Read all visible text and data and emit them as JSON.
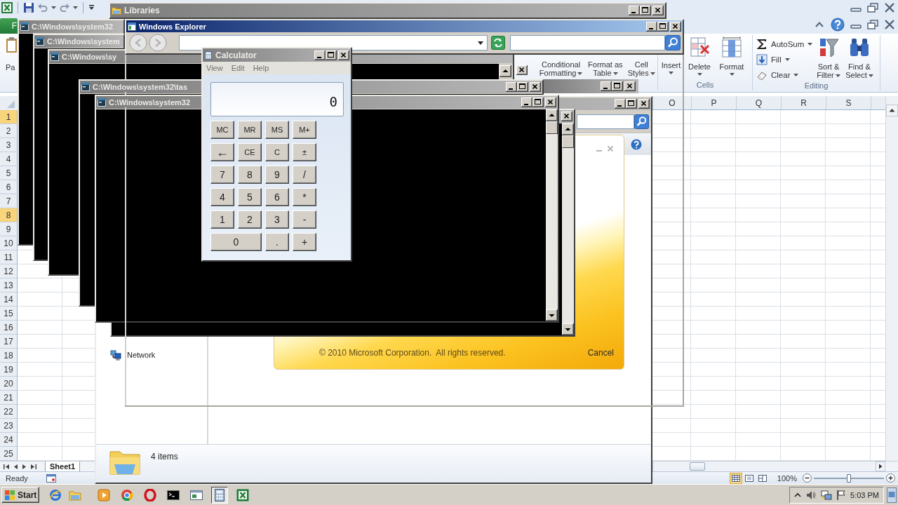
{
  "excel": {
    "file_tab": "F",
    "paste_label": "Pa",
    "styles_buttons": [
      "Conditional Formatting",
      "Format as Table",
      "Cell Styles"
    ],
    "cells_buttons": [
      "Insert",
      "Delete",
      "Format"
    ],
    "cells_group": "Cells",
    "editing_small": [
      "AutoSum",
      "Fill",
      "Clear"
    ],
    "editing_large": [
      "Sort & Filter",
      "Find & Select"
    ],
    "editing_group": "Editing",
    "columns": [
      "O",
      "P",
      "Q",
      "R",
      "S"
    ],
    "rows": [
      {
        "label": "1",
        "selected": true
      },
      {
        "label": "2",
        "selected": false
      },
      {
        "label": "3",
        "selected": false
      },
      {
        "label": "4",
        "selected": false
      },
      {
        "label": "5",
        "selected": false
      },
      {
        "label": "6",
        "selected": false
      },
      {
        "label": "7",
        "selected": false
      },
      {
        "label": "8",
        "selected": true
      },
      {
        "label": "9",
        "selected": false
      },
      {
        "label": "10",
        "selected": false
      },
      {
        "label": "11",
        "selected": false
      },
      {
        "label": "12",
        "selected": false
      },
      {
        "label": "13",
        "selected": false
      },
      {
        "label": "14",
        "selected": false
      },
      {
        "label": "15",
        "selected": false
      },
      {
        "label": "16",
        "selected": false
      },
      {
        "label": "17",
        "selected": false
      },
      {
        "label": "18",
        "selected": false
      },
      {
        "label": "19",
        "selected": false
      },
      {
        "label": "20",
        "selected": false
      },
      {
        "label": "21",
        "selected": false
      },
      {
        "label": "22",
        "selected": false
      },
      {
        "label": "23",
        "selected": false
      },
      {
        "label": "24",
        "selected": false
      },
      {
        "label": "25",
        "selected": false
      }
    ],
    "sheet_tabs": [
      {
        "label": "Sheet1",
        "selected": true
      }
    ],
    "status": "Ready",
    "view_buttons": [
      {
        "selected": true
      },
      {
        "selected": false
      },
      {
        "selected": false
      }
    ],
    "zoom": {
      "reading": "100%",
      "level": 0.5
    }
  },
  "libraries_window": {
    "title": "Libraries",
    "active": false
  },
  "consoles": [
    {
      "title": "C:\\Windows\\system32",
      "active": false
    },
    {
      "title": "C:\\Windows\\system",
      "active": false
    },
    {
      "title": "C:\\Windows\\sy",
      "active": false
    },
    {
      "title": "C:\\Windows\\system32\\tas",
      "active": false
    },
    {
      "title": "C:\\Windows\\system32",
      "active": false
    }
  ],
  "folder_window": {
    "active": false,
    "nav_items": [
      {
        "label": "Network"
      }
    ],
    "status": "4 items"
  },
  "setup_splash": {
    "copyright": "© 2010 Microsoft Corporation.  All rights reserved.",
    "cancel": "Cancel"
  },
  "explorer_window": {
    "title": "Windows Explorer",
    "active": true
  },
  "calculator": {
    "title": "Calculator",
    "active": false,
    "menu": [
      "View",
      "Edit",
      "Help"
    ],
    "display": "0",
    "keys": [
      {
        "label": "MC",
        "kind": "small"
      },
      {
        "label": "MR",
        "kind": "small"
      },
      {
        "label": "MS",
        "kind": "small"
      },
      {
        "label": "M+",
        "kind": "small"
      },
      {
        "label": "←",
        "kind": "arrow"
      },
      {
        "label": "CE",
        "kind": "small"
      },
      {
        "label": "C",
        "kind": "small"
      },
      {
        "label": "±",
        "kind": "small"
      },
      {
        "label": "7",
        "kind": "digit"
      },
      {
        "label": "8",
        "kind": "digit"
      },
      {
        "label": "9",
        "kind": "digit"
      },
      {
        "label": "/",
        "kind": "digit"
      },
      {
        "label": "4",
        "kind": "digit"
      },
      {
        "label": "5",
        "kind": "digit"
      },
      {
        "label": "6",
        "kind": "digit"
      },
      {
        "label": "*",
        "kind": "digit"
      },
      {
        "label": "1",
        "kind": "digit"
      },
      {
        "label": "2",
        "kind": "digit"
      },
      {
        "label": "3",
        "kind": "digit"
      },
      {
        "label": "-",
        "kind": "digit"
      },
      {
        "label": "0",
        "kind": "wide"
      },
      {
        "label": ".",
        "kind": "digit"
      },
      {
        "label": "+",
        "kind": "digit"
      }
    ]
  },
  "taskbar": {
    "start": "Start",
    "buttons": [
      {
        "selected": false
      },
      {
        "selected": false
      },
      {
        "selected": false
      },
      {
        "selected": false
      },
      {
        "selected": false
      },
      {
        "selected": true
      },
      {
        "selected": false
      }
    ],
    "time": "5:03 PM"
  }
}
